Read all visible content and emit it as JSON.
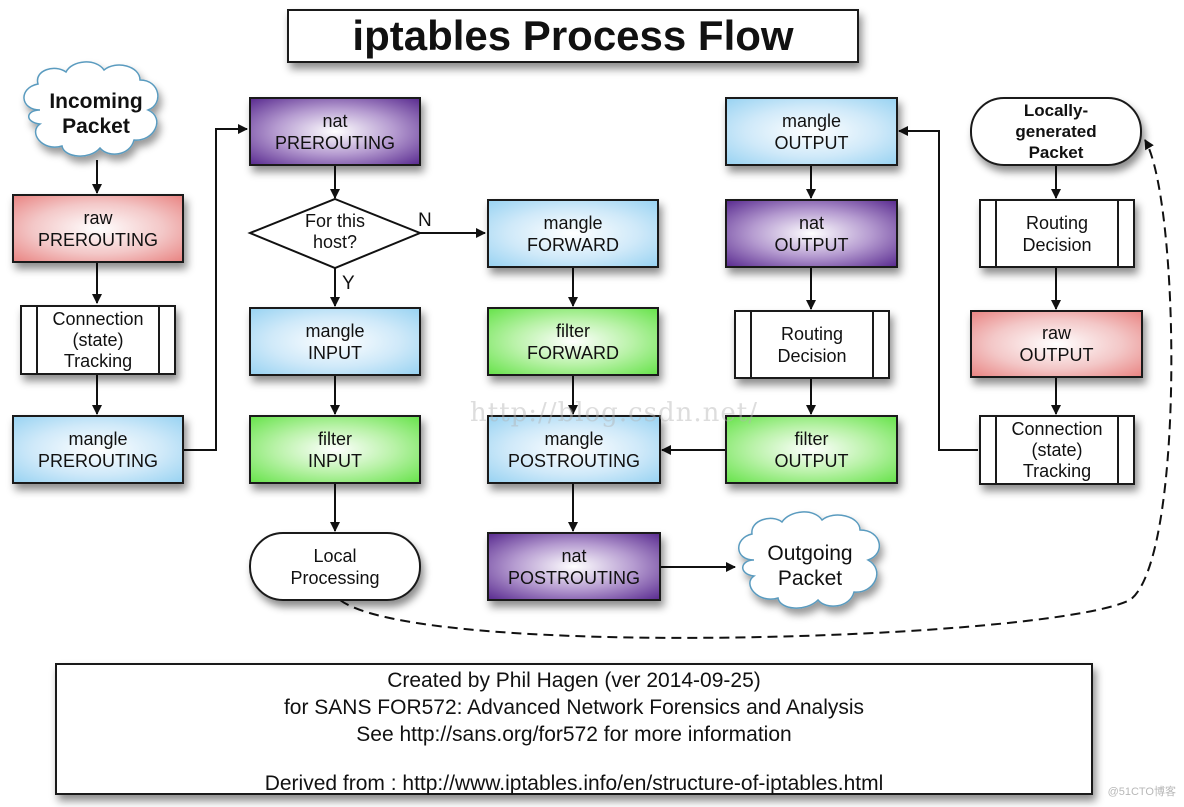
{
  "title": "iptables  Process Flow",
  "nodes": {
    "incoming_packet": {
      "line1": "Incoming",
      "line2": "Packet",
      "shape": "cloud"
    },
    "raw_prerouting": {
      "line1": "raw",
      "line2": "PREROUTING",
      "table": "raw"
    },
    "conntrack_in": {
      "line1": "Connection",
      "line2": "(state)",
      "line3": "Tracking",
      "shape": "process"
    },
    "mangle_prerouting": {
      "line1": "mangle",
      "line2": "PREROUTING",
      "table": "mangle"
    },
    "nat_prerouting": {
      "line1": "nat",
      "line2": "PREROUTING",
      "table": "nat"
    },
    "decision": {
      "line1": "For this",
      "line2": "host?",
      "yes": "Y",
      "no": "N"
    },
    "mangle_input": {
      "line1": "mangle",
      "line2": "INPUT",
      "table": "mangle"
    },
    "filter_input": {
      "line1": "filter",
      "line2": "INPUT",
      "table": "filter"
    },
    "local_processing": {
      "line1": "Local",
      "line2": "Processing",
      "shape": "terminal"
    },
    "mangle_forward": {
      "line1": "mangle",
      "line2": "FORWARD",
      "table": "mangle"
    },
    "filter_forward": {
      "line1": "filter",
      "line2": "FORWARD",
      "table": "filter"
    },
    "mangle_postrouting": {
      "line1": "mangle",
      "line2": "POSTROUTING",
      "table": "mangle"
    },
    "nat_postrouting": {
      "line1": "nat",
      "line2": "POSTROUTING",
      "table": "nat"
    },
    "outgoing_packet": {
      "line1": "Outgoing",
      "line2": "Packet",
      "shape": "cloud"
    },
    "mangle_output": {
      "line1": "mangle",
      "line2": "OUTPUT",
      "table": "mangle"
    },
    "nat_output": {
      "line1": "nat",
      "line2": "OUTPUT",
      "table": "nat"
    },
    "routing_decision_out": {
      "line1": "Routing",
      "line2": "Decision",
      "shape": "process"
    },
    "filter_output": {
      "line1": "filter",
      "line2": "OUTPUT",
      "table": "filter"
    },
    "locally_generated": {
      "line1": "Locally-",
      "line2": "generated",
      "line3": "Packet",
      "shape": "terminal"
    },
    "routing_decision_local": {
      "line1": "Routing",
      "line2": "Decision",
      "shape": "process"
    },
    "raw_output": {
      "line1": "raw",
      "line2": "OUTPUT",
      "table": "raw"
    },
    "conntrack_out": {
      "line1": "Connection",
      "line2": "(state)",
      "line3": "Tracking",
      "shape": "process"
    }
  },
  "edges": [
    {
      "from": "incoming_packet",
      "to": "raw_prerouting"
    },
    {
      "from": "raw_prerouting",
      "to": "conntrack_in"
    },
    {
      "from": "conntrack_in",
      "to": "mangle_prerouting"
    },
    {
      "from": "mangle_prerouting",
      "to": "nat_prerouting"
    },
    {
      "from": "nat_prerouting",
      "to": "decision"
    },
    {
      "from": "decision",
      "to": "mangle_input",
      "label": "Y"
    },
    {
      "from": "decision",
      "to": "mangle_forward",
      "label": "N"
    },
    {
      "from": "mangle_input",
      "to": "filter_input"
    },
    {
      "from": "filter_input",
      "to": "local_processing"
    },
    {
      "from": "mangle_forward",
      "to": "filter_forward"
    },
    {
      "from": "filter_forward",
      "to": "mangle_postrouting"
    },
    {
      "from": "mangle_postrouting",
      "to": "nat_postrouting"
    },
    {
      "from": "nat_postrouting",
      "to": "outgoing_packet"
    },
    {
      "from": "local_processing",
      "to": "locally_generated",
      "style": "dashed"
    },
    {
      "from": "locally_generated",
      "to": "routing_decision_local"
    },
    {
      "from": "routing_decision_local",
      "to": "raw_output"
    },
    {
      "from": "raw_output",
      "to": "conntrack_out"
    },
    {
      "from": "conntrack_out",
      "to": "mangle_output"
    },
    {
      "from": "mangle_output",
      "to": "nat_output"
    },
    {
      "from": "nat_output",
      "to": "routing_decision_out"
    },
    {
      "from": "routing_decision_out",
      "to": "filter_output"
    },
    {
      "from": "filter_output",
      "to": "mangle_postrouting"
    }
  ],
  "credits": {
    "line1": "Created by Phil Hagen (ver 2014-09-25)",
    "line2": "for SANS FOR572: Advanced Network Forensics and Analysis",
    "line3": "See http://sans.org/for572 for more information",
    "line4": "Derived from : http://www.iptables.info/en/structure-of-iptables.html"
  },
  "watermark": "http://blog.csdn.net/",
  "corner_mark": "@51CTO博客",
  "colors": {
    "raw": "#e98583",
    "mangle": "#99d3f2",
    "filter": "#68e34c",
    "nat": "#5b2d91",
    "line": "#1a1a1a"
  }
}
